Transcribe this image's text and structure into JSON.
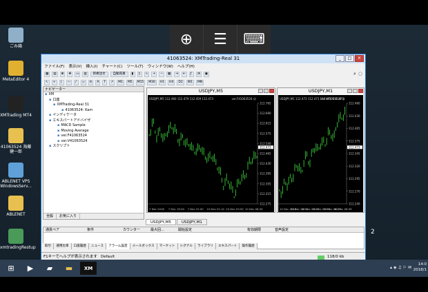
{
  "window": {
    "title": "41063524: XMTrading-Real 31"
  },
  "menu": [
    "ファイル(F)",
    "表示(V)",
    "挿入(I)",
    "チャート(C)",
    "ツール(T)",
    "ウィンドウ(W)",
    "ヘルプ(H)"
  ],
  "toolbar1": {
    "new_order": "新規注文",
    "auto_trade": "自動売買"
  },
  "toolbar2": [
    "M1",
    "M5",
    "M15",
    "M30",
    "H1",
    "H4",
    "D1",
    "W1",
    "MN"
  ],
  "desktop_icons": [
    {
      "label": "ごみ箱",
      "color": "#8fb0c8"
    },
    {
      "label": "MetaEditor 4",
      "color": "#e0b030"
    },
    {
      "label": "XMTrading MT4",
      "color": "#222222"
    },
    {
      "label": "41063524 海藤健一郎",
      "color": "#e8c050"
    },
    {
      "label": "ABLENET VPS WindowsServ...",
      "color": "#5fa0d8"
    },
    {
      "label": "ABLENET",
      "color": "#e8c050"
    },
    {
      "label": "xmtradingRestup",
      "color": "#4a9a5a"
    }
  ],
  "navigator": {
    "title": "ナビゲーター",
    "tree": [
      "XM",
      "口座",
      "XMTrading-Real 31",
      "41063524: Kam",
      "インディケータ",
      "エキスパートアドバイザ",
      "MACD Sample",
      "Moving Average",
      "ver.F41063524",
      "ver.V41063524",
      "スクリプト"
    ],
    "tabs": [
      "全般",
      "お気に入り"
    ]
  },
  "charts": [
    {
      "title": "USDJPY,M5",
      "info": "USDJPY,M5 112.460 112.479 112.459 112.473",
      "ea_label": "ver.F41063524 ☺",
      "price_labels": [
        "112.765",
        "112.690",
        "112.615",
        "112.575",
        "112.540",
        "112.465",
        "112.430",
        "112.395",
        "112.355",
        "112.315",
        "112.275"
      ],
      "current_price": "112.473",
      "time_labels": [
        "7 Dec 2018",
        "7 Dec 19:00",
        "7 Dec 22:00",
        "10 Dec 01:10",
        "10 Dec 03:50",
        "10 Dec 06:30"
      ]
    },
    {
      "title": "USDJPY,M1",
      "info": "USDJPY,M1 112.473 112.473 112.473 112.473",
      "ea_label": "ver.V41063524 ☺",
      "price_labels": [
        "112.460",
        "112.430",
        "112.405",
        "112.375",
        "112.345",
        "112.320",
        "112.295",
        "112.270",
        "112.240"
      ],
      "current_price": "112.473",
      "time_labels": [
        "10 Dec 2018",
        "10 Dec 04:51",
        "10 Dec 05:23",
        "10 Dec 05:55",
        "10 Dec 06:27",
        "10 Dec 06:59"
      ]
    }
  ],
  "chart_tabs": [
    "USDJPY,M5",
    "USDJPY,M1"
  ],
  "terminal": {
    "columns": [
      "通貨ペア",
      "条件",
      "カウンター",
      "最大回...",
      "開始設定",
      "有効期限",
      "音声設定"
    ],
    "tabs": [
      "取引",
      "運用比率",
      "口座履歴",
      "ニュース",
      "アラーム設定",
      "メールボックス",
      "マーケット",
      "シグナル",
      "ライブラリ",
      "エキスパート",
      "操作履歴"
    ],
    "active_tab": 4
  },
  "status": {
    "help": "F1キーでヘルプが表示されます",
    "profile": "Default",
    "traffic": "118/0 kb"
  },
  "clock": {
    "time": "14:0",
    "date": "2018/1"
  }
}
